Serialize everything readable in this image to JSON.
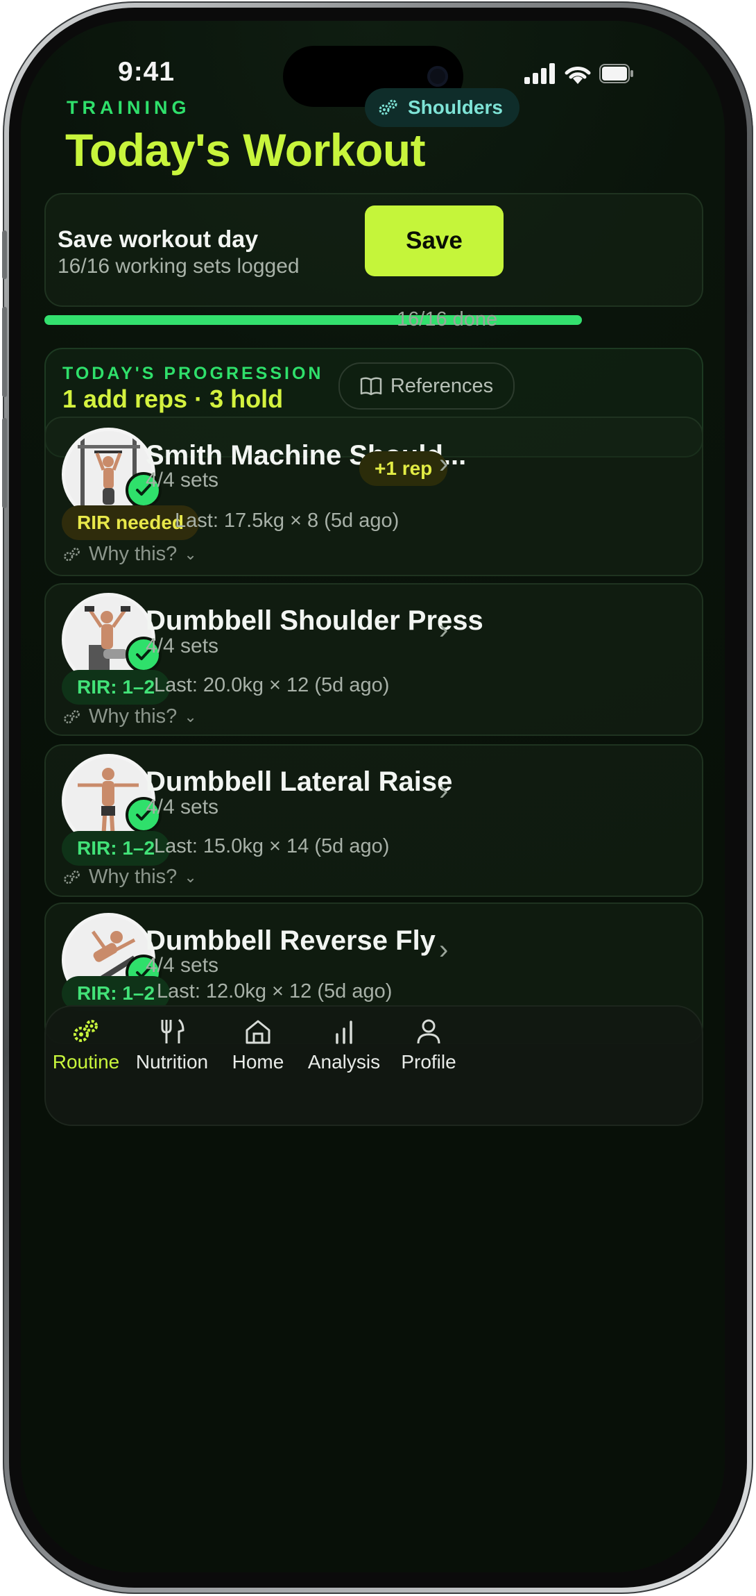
{
  "status_bar": {
    "time": "9:41"
  },
  "header": {
    "eyebrow": "TRAINING",
    "title": "Today's Workout",
    "muscle_tag": "Shoulders"
  },
  "save_card": {
    "title": "Save workout day",
    "subtitle": "16/16 working sets logged",
    "button_label": "Save"
  },
  "progress": {
    "fraction": 1.0,
    "label": "16/16 done"
  },
  "progression": {
    "eyebrow": "TODAY'S PROGRESSION",
    "summary": "1 add reps · 3 hold",
    "references_label": "References"
  },
  "exercises": [
    {
      "name": "Smith Machine Should...",
      "sets": "4/4 sets",
      "badge": "+1 rep",
      "pill": "RIR needed",
      "last": "Last: 17.5kg × 8  (5d ago)",
      "why": "Why this?"
    },
    {
      "name": "Dumbbell Shoulder Press",
      "sets": "4/4 sets",
      "pill": "RIR: 1–2",
      "last": "Last: 20.0kg × 12  (5d ago)",
      "why": "Why this?"
    },
    {
      "name": "Dumbbell Lateral Raise",
      "sets": "4/4 sets",
      "pill": "RIR: 1–2",
      "last": "Last: 15.0kg × 14  (5d ago)",
      "why": "Why this?"
    },
    {
      "name": "Dumbbell Reverse Fly",
      "sets": "4/4 sets",
      "pill": "RIR: 1–2",
      "last": "Last: 12.0kg × 12  (5d ago)"
    }
  ],
  "nav": [
    {
      "label": "Routine",
      "icon": "gears-icon",
      "active": true
    },
    {
      "label": "Nutrition",
      "icon": "fork-knife-icon"
    },
    {
      "label": "Home",
      "icon": "home-icon"
    },
    {
      "label": "Analysis",
      "icon": "bar-chart-icon"
    },
    {
      "label": "Profile",
      "icon": "person-icon"
    }
  ],
  "colors": {
    "accent_lime": "#c8f53c",
    "accent_green": "#2fe06b",
    "background": "#0a140b"
  }
}
